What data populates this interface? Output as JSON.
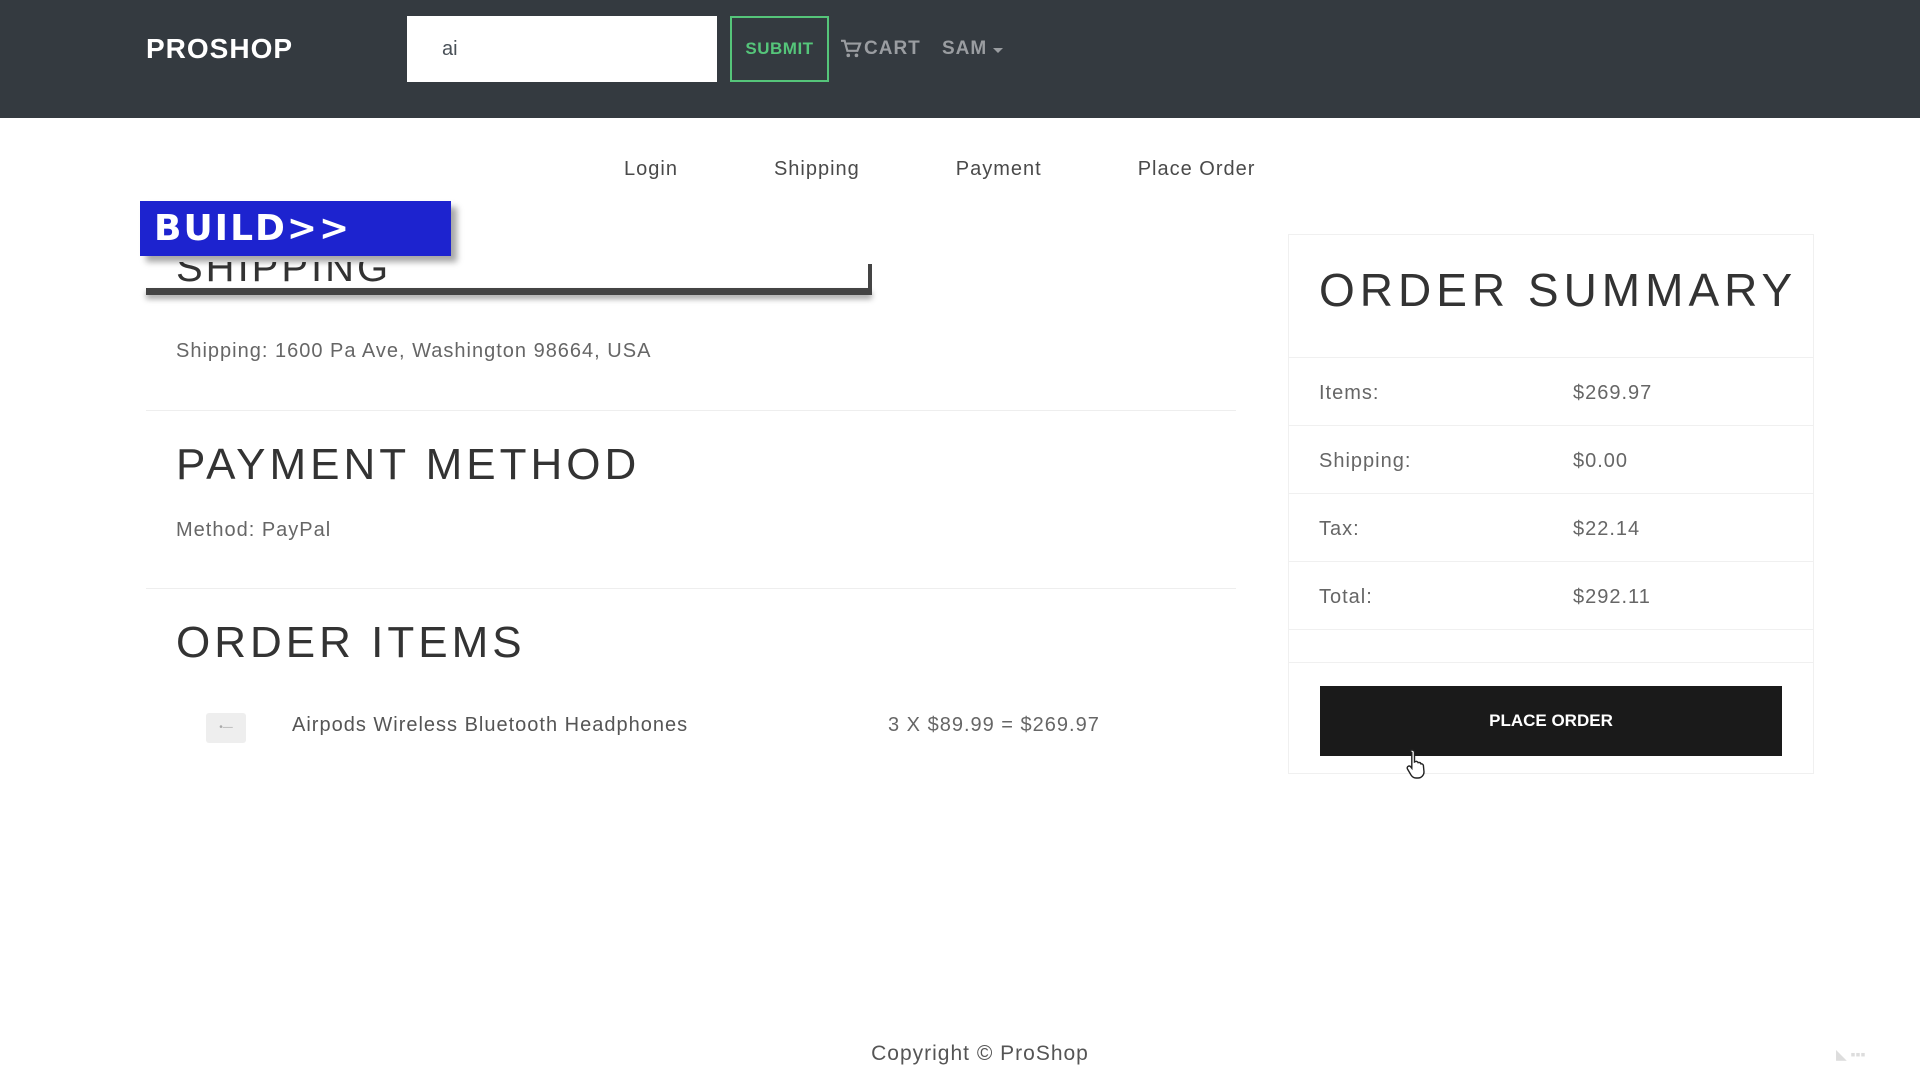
{
  "navbar": {
    "brand": "PROSHOP",
    "search_value": "ai",
    "submit_label": "SUBMIT",
    "cart_label": "CART",
    "user_label": "SAM"
  },
  "checkout_steps": [
    "Login",
    "Shipping",
    "Payment",
    "Place Order"
  ],
  "overlay": {
    "banner_text": "BUILD>>"
  },
  "shipping": {
    "heading": "SHIPPING",
    "line": "Shipping: 1600 Pa Ave, Washington 98664, USA"
  },
  "payment": {
    "heading": "PAYMENT METHOD",
    "line": "Method: PayPal"
  },
  "order_items": {
    "heading": "ORDER ITEMS",
    "items": [
      {
        "name": "Airpods Wireless Bluetooth Headphones",
        "price_line": "3 X $89.99 = $269.97"
      }
    ]
  },
  "summary": {
    "title": "ORDER SUMMARY",
    "rows": [
      {
        "label": "Items:",
        "value": "$269.97"
      },
      {
        "label": "Shipping:",
        "value": "$0.00"
      },
      {
        "label": "Tax:",
        "value": "$22.14"
      },
      {
        "label": "Total:",
        "value": "$292.11"
      }
    ],
    "button_label": "PLACE ORDER"
  },
  "footer": {
    "text": "Copyright © ProShop"
  },
  "colors": {
    "navbar_bg": "#343a40",
    "submit_accent": "#55c57a",
    "banner_bg": "#1d23cf",
    "place_order_bg": "#1a1a1a"
  },
  "icons": [
    "shopping-cart-icon",
    "caret-down-icon",
    "product-thumbnail",
    "mouse-pointer-icon"
  ]
}
